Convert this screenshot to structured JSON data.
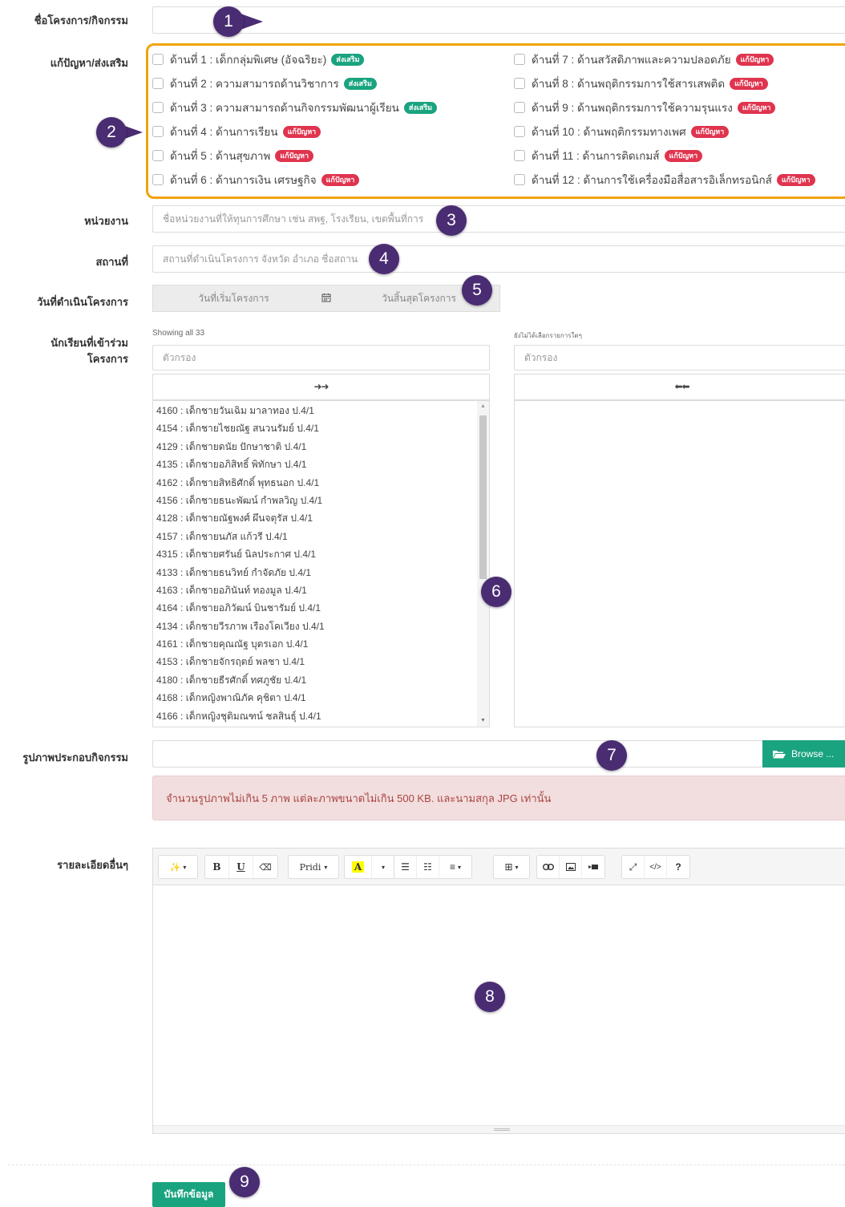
{
  "labels": {
    "project_name": "ชื่อโครงการ/กิจกรรม",
    "category": "แก้ปัญหา/ส่งเสริม",
    "agency": "หน่วยงาน",
    "place": "สถานที่",
    "date": "วันที่ดำเนินโครงการ",
    "students_line1": "นักเรียนที่เข้าร่วม",
    "students_line2": "โครงการ",
    "images": "รูปภาพประกอบกิจกรรม",
    "details": "รายละเอียดอื่นๆ"
  },
  "fields": {
    "agency_placeholder": "ชื่อหน่วยงานที่ให้ทุนการศึกษา เช่น สพฐ, โรงเรียน, เขตพื้นที่การ",
    "place_placeholder": "สถานที่ดำเนินโครงการ จังหวัด อำเภอ ชื่อสถาน",
    "start_date_placeholder": "วันที่เริ่มโครงการ",
    "end_date_placeholder": "วันสิ้นสุดโครงการ"
  },
  "categories_left": [
    {
      "label": "ด้านที่ 1 : เด็กกลุ่มพิเศษ (อัจฉริยะ)",
      "badge": "ส่งเสริม",
      "type": "promote"
    },
    {
      "label": "ด้านที่ 2 : ความสามารถด้านวิชาการ",
      "badge": "ส่งเสริม",
      "type": "promote"
    },
    {
      "label": "ด้านที่ 3 : ความสามารถด้านกิจกรรมพัฒนาผู้เรียน",
      "badge": "ส่งเสริม",
      "type": "promote"
    },
    {
      "label": "ด้านที่ 4 : ด้านการเรียน",
      "badge": "แก้ปัญหา",
      "type": "problem"
    },
    {
      "label": "ด้านที่ 5 : ด้านสุขภาพ",
      "badge": "แก้ปัญหา",
      "type": "problem"
    },
    {
      "label": "ด้านที่ 6 : ด้านการเงิน เศรษฐกิจ",
      "badge": "แก้ปัญหา",
      "type": "problem"
    }
  ],
  "categories_right": [
    {
      "label": "ด้านที่ 7 : ด้านสวัสดิภาพและความปลอดภัย",
      "badge": "แก้ปัญหา",
      "type": "problem"
    },
    {
      "label": "ด้านที่ 8 : ด้านพฤติกรรมการใช้สารเสพติด",
      "badge": "แก้ปัญหา",
      "type": "problem"
    },
    {
      "label": "ด้านที่ 9 : ด้านพฤติกรรมการใช้ความรุนแรง",
      "badge": "แก้ปัญหา",
      "type": "problem"
    },
    {
      "label": "ด้านที่ 10 : ด้านพฤติกรรมทางเพศ",
      "badge": "แก้ปัญหา",
      "type": "problem"
    },
    {
      "label": "ด้านที่ 11 : ด้านการติดเกมส์",
      "badge": "แก้ปัญหา",
      "type": "problem"
    },
    {
      "label": "ด้านที่ 12 : ด้านการใช้เครื่องมือสื่อสารอิเล็กทรอนิกส์",
      "badge": "แก้ปัญหา",
      "type": "problem"
    }
  ],
  "dual_list": {
    "left_info": "Showing all 33",
    "right_info": "ยังไม่ได้เลือกรายการใดๆ",
    "filter_placeholder": "ตัวกรอง",
    "move_all": "➜➜",
    "remove_all": "⬅⬅",
    "students": [
      "4160 : เด็กชายวันเฉิม มาลาทอง ป.4/1",
      "4154 : เด็กชายไชยณัฐ สนวนรัมย์ ป.4/1",
      "4129 : เด็กชายดนัย ปักษาชาติ ป.4/1",
      "4135 : เด็กชายอภิสิทธิ์ พิทักษา ป.4/1",
      "4162 : เด็กชายสิทธิศักดิ์ พุทธนอก ป.4/1",
      "4156 : เด็กชายธนะพัฒน์ กำพลวิญ ป.4/1",
      "4128 : เด็กชายณัฐพงศ์ ผึนจตุรัส ป.4/1",
      "4157 : เด็กชายนภัส แก้วรี ป.4/1",
      "4315 : เด็กชายศรันย์ นิลประกาศ ป.4/1",
      "4133 : เด็กชายธนวิทย์ กำจัดภัย ป.4/1",
      "4163 : เด็กชายอภินันท์ ทองมูล ป.4/1",
      "4164 : เด็กชายอภิวัฒน์ บินชารัมย์ ป.4/1",
      "4134 : เด็กชายวีรภาพ เรืองโคเวียง ป.4/1",
      "4161 : เด็กชายคุณณัฐ บุตรเอก ป.4/1",
      "4153 : เด็กชายจักรฤตย์ พลชา ป.4/1",
      "4180 : เด็กชายธีรศักดิ์ ทศภูชัย ป.4/1",
      "4168 : เด็กหญิงพาณิภัค คุชิตา ป.4/1",
      "4166 : เด็กหญิงชุติมณฑน์ ชลสินธุ์ ป.4/1"
    ]
  },
  "upload": {
    "browse_label": "Browse ..."
  },
  "alert": {
    "text": "จำนวนรูปภาพไม่เกิน 5 ภาพ แต่ละภาพขนาดไม่เกิน 500 KB. และนามสกุล JPG เท่านั้น"
  },
  "editor_toolbar": {
    "style": "✨",
    "bold": "B",
    "underline": "U",
    "eraser": "⌫",
    "font_name": "Pridi",
    "color_letter": "A",
    "ul": "☰",
    "ol": "☷",
    "align": "≡",
    "table": "⊞",
    "link": "🔗",
    "picture": "▣",
    "video": "▶",
    "fullscreen": "⤢",
    "code": "</>",
    "help": "?"
  },
  "submit": {
    "label": "บันทึกข้อมูล"
  },
  "markers": [
    "1",
    "2",
    "3",
    "4",
    "5",
    "6",
    "7",
    "8",
    "9"
  ],
  "colors": {
    "highlight_border": "#f0a30a",
    "marker": "#4a2c73",
    "promote_badge": "#1aa37f",
    "problem_badge": "#e0344e",
    "primary_button": "#1aa37f",
    "alert_bg": "#f2dede",
    "alert_text": "#a94442"
  }
}
